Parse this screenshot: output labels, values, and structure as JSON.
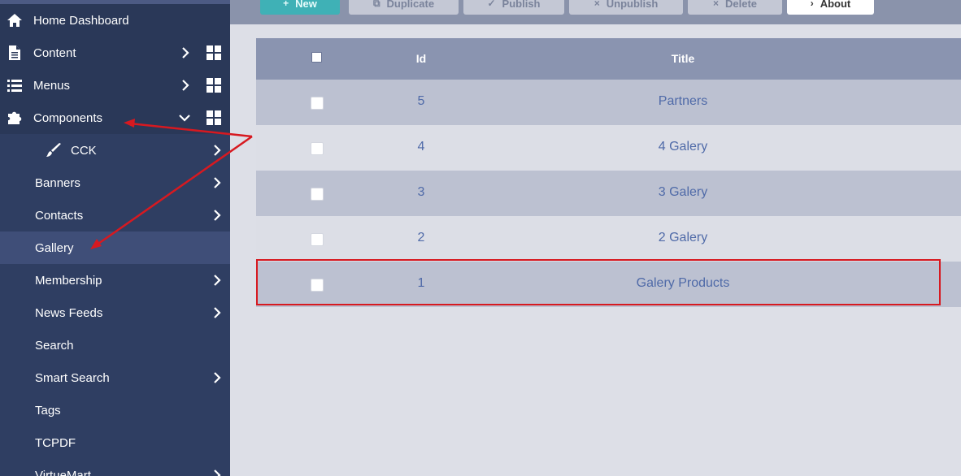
{
  "sidebar": {
    "items": [
      {
        "label": "Home Dashboard",
        "icon": "home-icon"
      },
      {
        "label": "Content",
        "icon": "document-icon"
      },
      {
        "label": "Menus",
        "icon": "list-icon"
      },
      {
        "label": "Components",
        "icon": "puzzle-icon"
      }
    ],
    "sub_items": [
      {
        "label": "CCK",
        "icon": "brush-icon"
      },
      {
        "label": "Banners"
      },
      {
        "label": "Contacts"
      },
      {
        "label": "Gallery"
      },
      {
        "label": "Membership"
      },
      {
        "label": "News Feeds"
      },
      {
        "label": "Search"
      },
      {
        "label": "Smart Search"
      },
      {
        "label": "Tags"
      },
      {
        "label": "TCPDF"
      },
      {
        "label": "VirtueMart"
      }
    ]
  },
  "toolbar": {
    "buttons": [
      {
        "label": "New",
        "icon": "plus-icon"
      },
      {
        "label": "Duplicate",
        "icon": "copy-icon"
      },
      {
        "label": "Publish",
        "icon": "check-icon"
      },
      {
        "label": "Unpublish",
        "icon": "times-icon"
      },
      {
        "label": "Delete",
        "icon": "times-icon"
      },
      {
        "label": "About",
        "icon": "info-icon"
      }
    ]
  },
  "table": {
    "columns": {
      "id": "Id",
      "title": "Title"
    },
    "rows": [
      {
        "id": "5",
        "title": "Partners"
      },
      {
        "id": "4",
        "title": "4 Galery"
      },
      {
        "id": "3",
        "title": "3 Galery"
      },
      {
        "id": "2",
        "title": "2 Galery"
      },
      {
        "id": "1",
        "title": "Galery Products"
      }
    ]
  },
  "colors": {
    "sidebar_bg": "#2a3858",
    "active_item": "#3f4e78",
    "new_button": "#3fb1b6",
    "annotation_red": "#d71920",
    "link_blue": "#4f6aa8"
  }
}
